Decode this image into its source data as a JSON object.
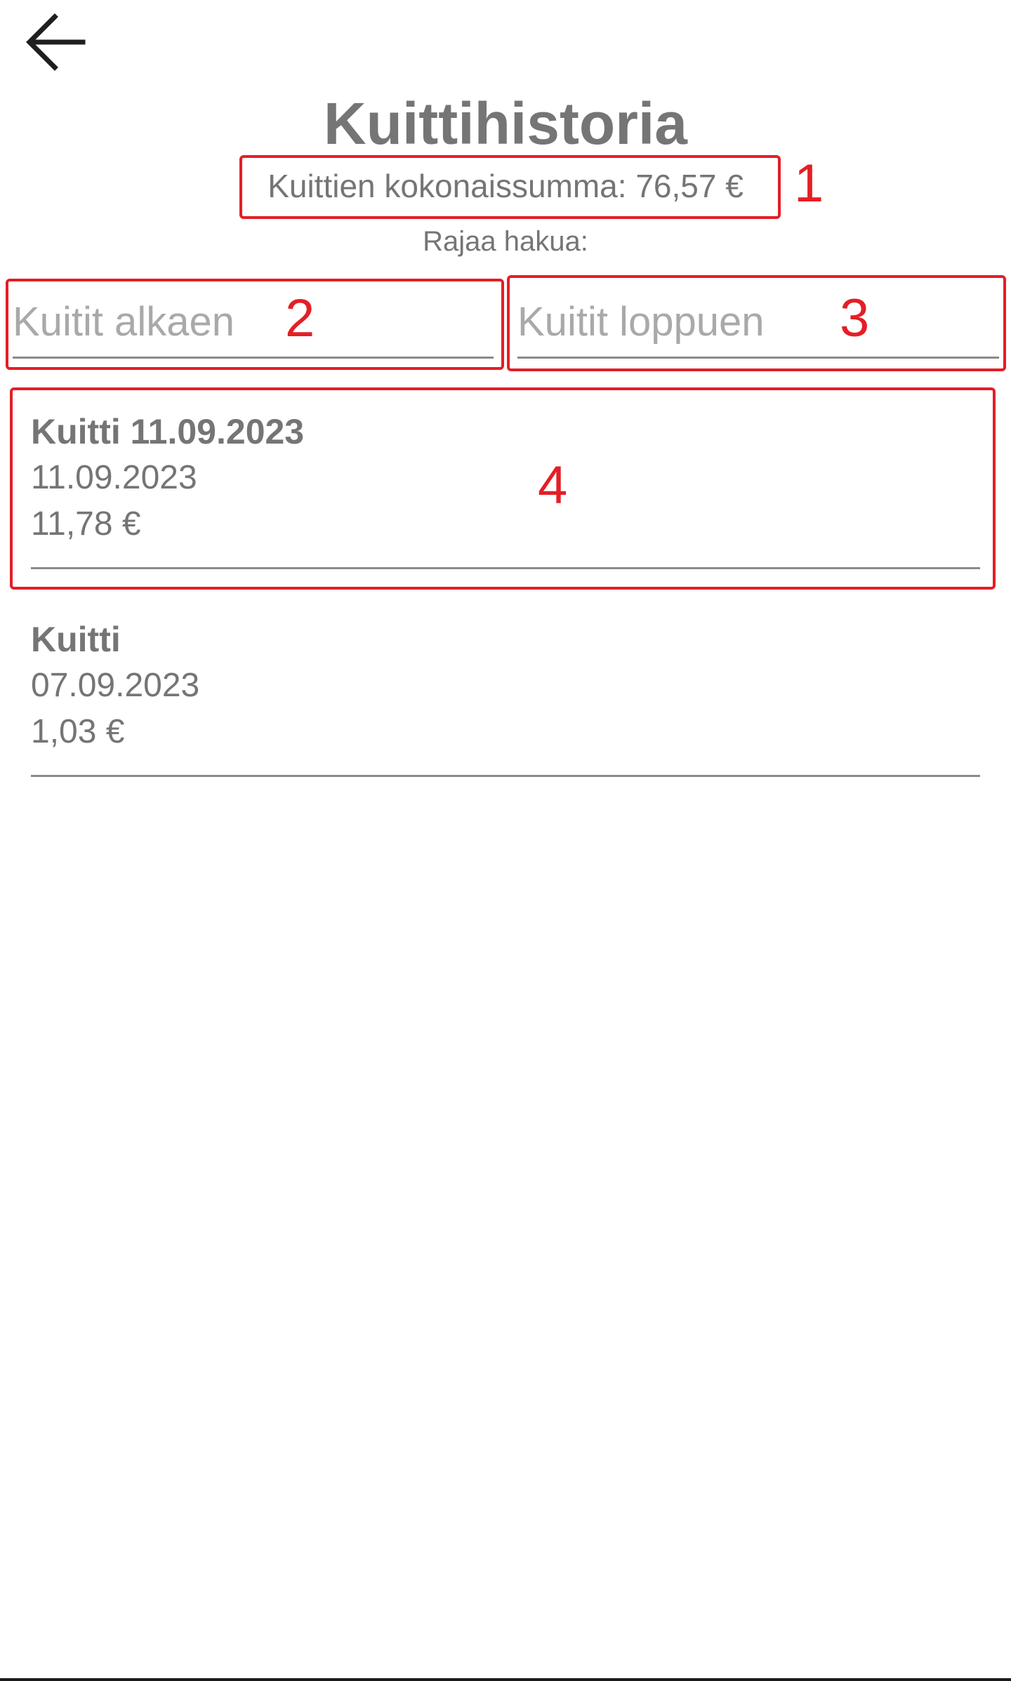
{
  "header": {
    "back_icon": "arrow-left-icon",
    "title": "Kuittihistoria"
  },
  "summary": {
    "total_text": "Kuittien kokonaissumma: 76,57 €"
  },
  "filter": {
    "label": "Rajaa hakua:",
    "start_placeholder": "Kuitit alkaen",
    "end_placeholder": "Kuitit loppuen"
  },
  "receipts": [
    {
      "name": "Kuitti 11.09.2023",
      "date": "11.09.2023",
      "amount": "11,78 €"
    },
    {
      "name": "Kuitti",
      "date": "07.09.2023",
      "amount": "1,03 €"
    }
  ],
  "annotations": [
    "1",
    "2",
    "3",
    "4"
  ],
  "colors": {
    "text_gray": "#757575",
    "annotation_red": "#e41e26",
    "divider": "#8a8a8a"
  }
}
